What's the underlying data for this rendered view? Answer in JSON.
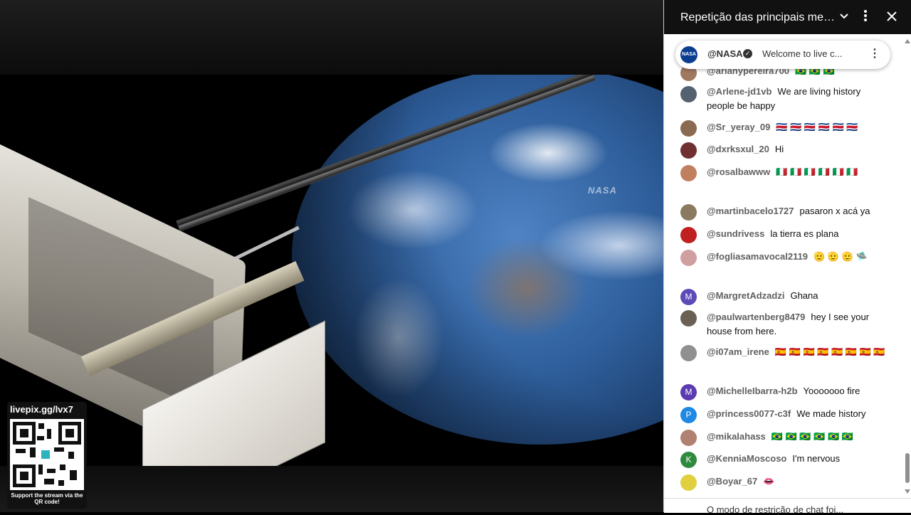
{
  "video": {
    "watermark": "NASA",
    "capsule_logo": "NASA",
    "qr_url": "livepix.gg/lvx7",
    "qr_caption": "Support the stream via the QR code!"
  },
  "chat": {
    "title": "Repetição das principais mens...",
    "pinned": {
      "logo": "NASA",
      "author": "@NASA",
      "text": "Welcome to live c..."
    },
    "messages": [
      {
        "author": "@arianypereira700",
        "text": "🇧🇷 🇧🇷 🇧🇷",
        "avatar_color": "#a07860",
        "avatar_letter": ""
      },
      {
        "author": "@Arlene-jd1vb",
        "text": "We are living history people be happy",
        "avatar_color": "#556070",
        "avatar_letter": ""
      },
      {
        "author": "@Sr_yeray_09",
        "text": "🇨🇷 🇨🇷 🇨🇷 🇨🇷 🇨🇷 🇨🇷",
        "avatar_color": "#8a6a50",
        "avatar_letter": ""
      },
      {
        "author": "@dxrksxul_20",
        "text": "Hi",
        "avatar_color": "#703030",
        "avatar_letter": ""
      },
      {
        "author": "@rosalbawww",
        "text": "🇮🇹 🇮🇹 🇮🇹 🇮🇹 🇮🇹 🇮🇹",
        "avatar_color": "#c08060",
        "avatar_letter": ""
      },
      {
        "author": "@martinbacelo1727",
        "text": "pasaron x acá ya",
        "avatar_color": "#8a7a60",
        "avatar_letter": ""
      },
      {
        "author": "@sundrivess",
        "text": "la tierra es plana",
        "avatar_color": "#c02020",
        "avatar_letter": ""
      },
      {
        "author": "@fogliasamavocal2119",
        "text": "🫡 🫡 🫡 🛸",
        "avatar_color": "#d0a0a0",
        "avatar_letter": ""
      },
      {
        "author": "@MargretAdzadzi",
        "text": "Ghana",
        "avatar_color": "#5c4ab8",
        "avatar_letter": "M"
      },
      {
        "author": "@paulwartenberg8479",
        "text": "hey I see your house from here.",
        "avatar_color": "#6a6055",
        "avatar_letter": ""
      },
      {
        "author": "@i07am_irene",
        "text": "🇪🇸 🇪🇸 🇪🇸 🇪🇸 🇪🇸 🇪🇸 🇪🇸 🇪🇸",
        "avatar_color": "#909090",
        "avatar_letter": ""
      },
      {
        "author": "@MichelleIbarra-h2b",
        "text": "Yooooooo fire",
        "avatar_color": "#5c3ab0",
        "avatar_letter": "M"
      },
      {
        "author": "@princess0077-c3f",
        "text": "We made history",
        "avatar_color": "#1e88e5",
        "avatar_letter": "P"
      },
      {
        "author": "@mikalahass",
        "text": "🇧🇷 🇧🇷 🇧🇷 🇧🇷 🇧🇷 🇧🇷",
        "avatar_color": "#b08070",
        "avatar_letter": ""
      },
      {
        "author": "@KenniaMoscoso",
        "text": "I'm nervous",
        "avatar_color": "#2e8b3e",
        "avatar_letter": "K"
      },
      {
        "author": "@Boyar_67",
        "text": "👄",
        "avatar_color": "#e0d040",
        "avatar_letter": ""
      }
    ],
    "restriction_text": "O modo de restrição de chat foi..."
  },
  "colors": {
    "header_bg": "#111111",
    "author_text": "#606060",
    "message_text": "#0f0f0f"
  }
}
